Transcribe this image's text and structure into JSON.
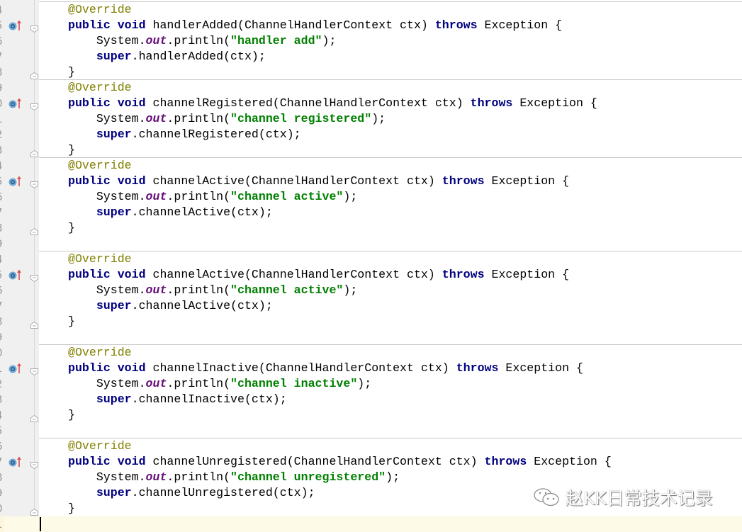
{
  "colors": {
    "keyword": "#000080",
    "annotation": "#808000",
    "string": "#008000",
    "field": "#660e7a",
    "current_line": "#fefae8"
  },
  "icons": {
    "override": "override-method-icon",
    "fold": "fold-marker-icon",
    "watermark": "wechat-icon"
  },
  "watermark": "赵KK日常技术记录",
  "lines": [
    {
      "n": "4",
      "sep": true,
      "t": [
        [
          "ann",
          "@Override"
        ]
      ]
    },
    {
      "n": "5",
      "ovr": true,
      "fold": "open",
      "t": [
        [
          "kw",
          "public void "
        ],
        [
          "",
          "handlerAdded(ChannelHandlerContext ctx) "
        ],
        [
          "kw",
          "throws "
        ],
        [
          "",
          "Exception {"
        ]
      ]
    },
    {
      "n": "6",
      "t": [
        [
          "",
          "    System."
        ],
        [
          "fld",
          "out"
        ],
        [
          "",
          ".println("
        ],
        [
          "str",
          "\"handler add\""
        ],
        [
          "",
          ");"
        ]
      ]
    },
    {
      "n": "7",
      "t": [
        [
          "kw",
          "    super"
        ],
        [
          "",
          ".handlerAdded(ctx);"
        ]
      ]
    },
    {
      "n": "8",
      "fold": "close",
      "t": [
        [
          "",
          "}"
        ]
      ]
    },
    {
      "n": "9",
      "sep": true,
      "t": [
        [
          "ann",
          "@Override"
        ]
      ]
    },
    {
      "n": "0",
      "ovr": true,
      "fold": "open",
      "t": [
        [
          "kw",
          "public void "
        ],
        [
          "",
          "channelRegistered(ChannelHandlerContext ctx) "
        ],
        [
          "kw",
          "throws "
        ],
        [
          "",
          "Exception {"
        ]
      ]
    },
    {
      "n": "1",
      "t": [
        [
          "",
          "    System."
        ],
        [
          "fld",
          "out"
        ],
        [
          "",
          ".println("
        ],
        [
          "str",
          "\"channel registered\""
        ],
        [
          "",
          ");"
        ]
      ]
    },
    {
      "n": "2",
      "t": [
        [
          "kw",
          "    super"
        ],
        [
          "",
          ".channelRegistered(ctx);"
        ]
      ]
    },
    {
      "n": "3",
      "fold": "close",
      "t": [
        [
          "",
          "}"
        ]
      ]
    },
    {
      "n": "4",
      "sep": true,
      "t": [
        [
          "ann",
          "@Override"
        ]
      ]
    },
    {
      "n": "5",
      "ovr": true,
      "fold": "open",
      "t": [
        [
          "kw",
          "public void "
        ],
        [
          "",
          "channelActive(ChannelHandlerContext ctx) "
        ],
        [
          "kw",
          "throws "
        ],
        [
          "",
          "Exception {"
        ]
      ]
    },
    {
      "n": "6",
      "t": [
        [
          "",
          "    System."
        ],
        [
          "fld",
          "out"
        ],
        [
          "",
          ".println("
        ],
        [
          "str",
          "\"channel active\""
        ],
        [
          "",
          ");"
        ]
      ]
    },
    {
      "n": "7",
      "t": [
        [
          "kw",
          "    super"
        ],
        [
          "",
          ".channelActive(ctx);"
        ]
      ]
    },
    {
      "n": "8",
      "fold": "close",
      "t": [
        [
          "",
          "}"
        ]
      ]
    },
    {
      "n": "9",
      "t": []
    },
    {
      "n": "4",
      "sep": true,
      "t": [
        [
          "ann",
          "@Override"
        ]
      ]
    },
    {
      "n": "5",
      "ovr": true,
      "fold": "open",
      "t": [
        [
          "kw",
          "public void "
        ],
        [
          "",
          "channelActive(ChannelHandlerContext ctx) "
        ],
        [
          "kw",
          "throws "
        ],
        [
          "",
          "Exception {"
        ]
      ]
    },
    {
      "n": "6",
      "t": [
        [
          "",
          "    System."
        ],
        [
          "fld",
          "out"
        ],
        [
          "",
          ".println("
        ],
        [
          "str",
          "\"channel active\""
        ],
        [
          "",
          ");"
        ]
      ]
    },
    {
      "n": "7",
      "t": [
        [
          "kw",
          "    super"
        ],
        [
          "",
          ".channelActive(ctx);"
        ]
      ]
    },
    {
      "n": "8",
      "fold": "close",
      "t": [
        [
          "",
          "}"
        ]
      ]
    },
    {
      "n": "9",
      "t": []
    },
    {
      "n": "0",
      "sep": true,
      "t": [
        [
          "ann",
          "@Override"
        ]
      ]
    },
    {
      "n": "1",
      "ovr": true,
      "fold": "open",
      "t": [
        [
          "kw",
          "public void "
        ],
        [
          "",
          "channelInactive(ChannelHandlerContext ctx) "
        ],
        [
          "kw",
          "throws "
        ],
        [
          "",
          "Exception {"
        ]
      ]
    },
    {
      "n": "2",
      "t": [
        [
          "",
          "    System."
        ],
        [
          "fld",
          "out"
        ],
        [
          "",
          ".println("
        ],
        [
          "str",
          "\"channel inactive\""
        ],
        [
          "",
          ");"
        ]
      ]
    },
    {
      "n": "3",
      "t": [
        [
          "kw",
          "    super"
        ],
        [
          "",
          ".channelInactive(ctx);"
        ]
      ]
    },
    {
      "n": "4",
      "fold": "close",
      "t": [
        [
          "",
          "}"
        ]
      ]
    },
    {
      "n": "5",
      "t": []
    },
    {
      "n": "6",
      "sep": true,
      "t": [
        [
          "ann",
          "@Override"
        ]
      ]
    },
    {
      "n": "7",
      "ovr": true,
      "fold": "open",
      "t": [
        [
          "kw",
          "public void "
        ],
        [
          "",
          "channelUnregistered(ChannelHandlerContext ctx) "
        ],
        [
          "kw",
          "throws "
        ],
        [
          "",
          "Exception {"
        ]
      ]
    },
    {
      "n": "8",
      "t": [
        [
          "",
          "    System."
        ],
        [
          "fld",
          "out"
        ],
        [
          "",
          ".println("
        ],
        [
          "str",
          "\"channel unregistered\""
        ],
        [
          "",
          ");"
        ]
      ]
    },
    {
      "n": "9",
      "t": [
        [
          "kw",
          "    super"
        ],
        [
          "",
          ".channelUnregistered(ctx);"
        ]
      ]
    },
    {
      "n": "0",
      "fold": "close",
      "t": [
        [
          "",
          "}"
        ]
      ]
    },
    {
      "n": "1",
      "current": true,
      "t": []
    }
  ]
}
